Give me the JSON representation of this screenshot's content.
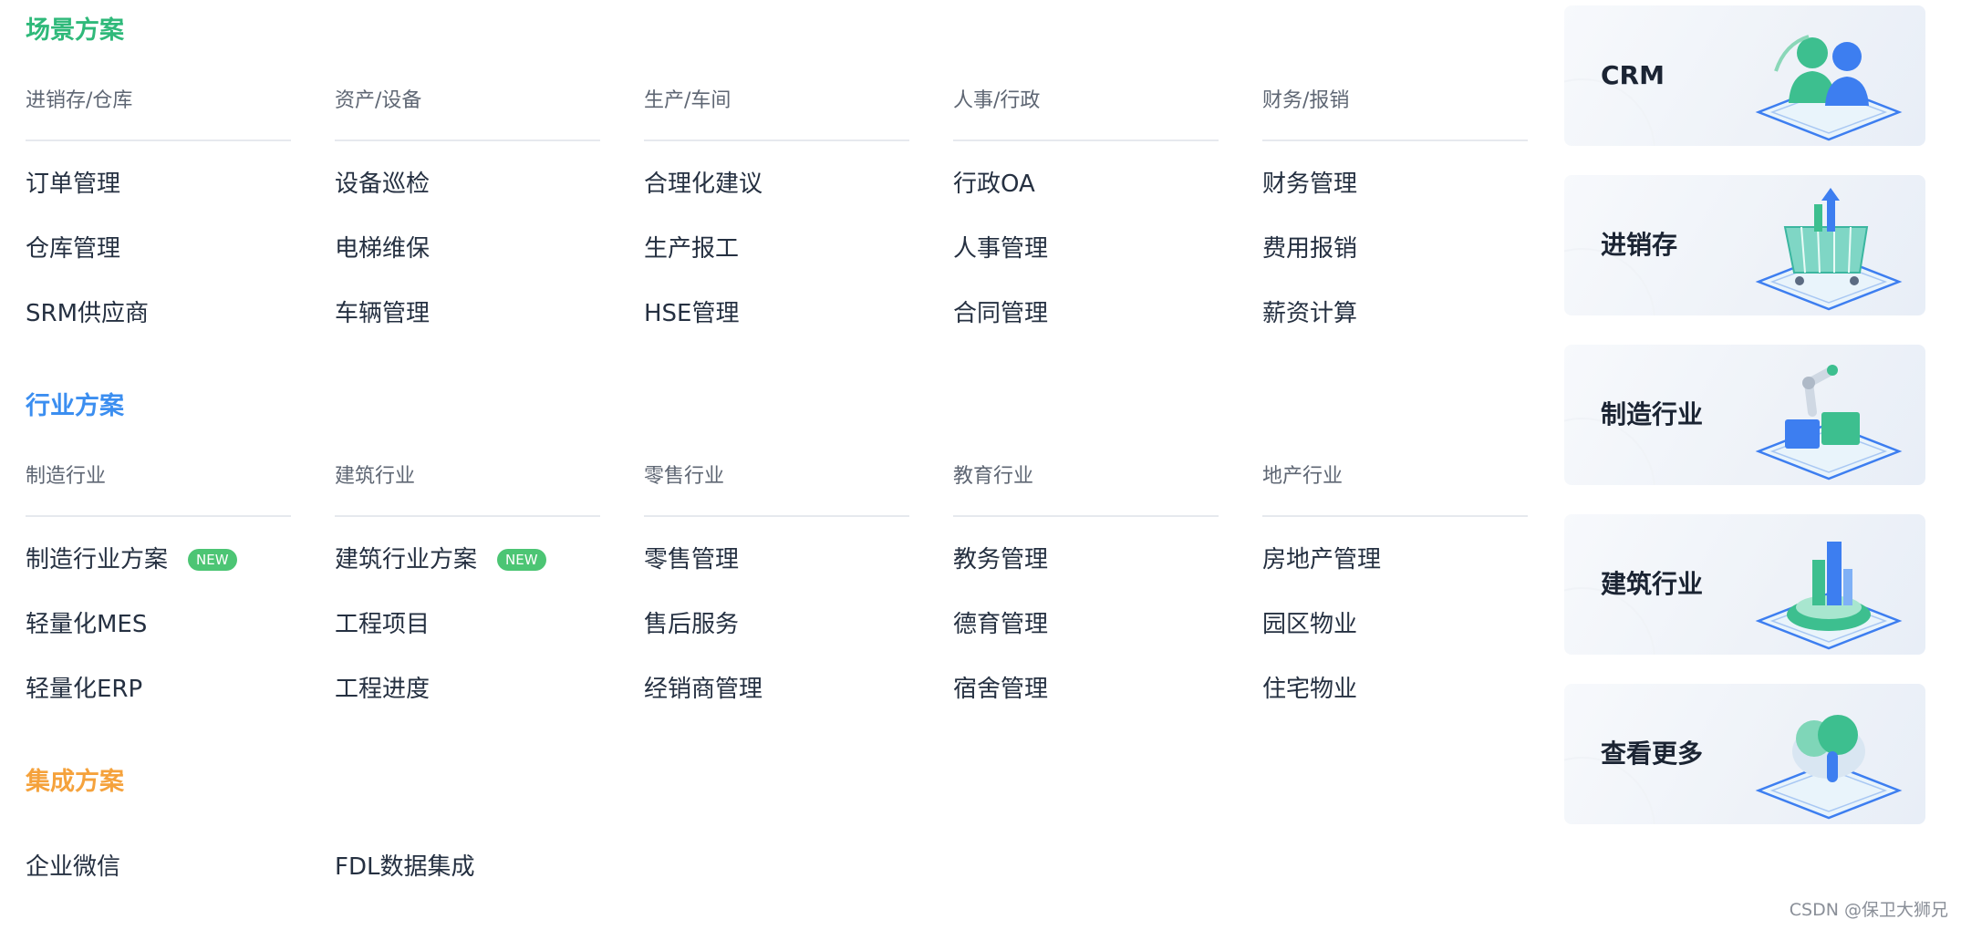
{
  "sections": {
    "scene": {
      "title": "场景方案",
      "color": "#2fb97a",
      "columns": [
        {
          "head": "进销存/仓库",
          "items": [
            "订单管理",
            "仓库管理",
            "SRM供应商"
          ]
        },
        {
          "head": "资产/设备",
          "items": [
            "设备巡检",
            "电梯维保",
            "车辆管理"
          ]
        },
        {
          "head": "生产/车间",
          "items": [
            "合理化建议",
            "生产报工",
            "HSE管理"
          ]
        },
        {
          "head": "人事/行政",
          "items": [
            "行政OA",
            "人事管理",
            "合同管理"
          ]
        },
        {
          "head": "财务/报销",
          "items": [
            "财务管理",
            "费用报销",
            "薪资计算"
          ]
        }
      ]
    },
    "industry": {
      "title": "行业方案",
      "color": "#3b8ef0",
      "columns": [
        {
          "head": "制造行业",
          "items": [
            "制造行业方案",
            "轻量化MES",
            "轻量化ERP"
          ]
        },
        {
          "head": "建筑行业",
          "items": [
            "建筑行业方案",
            "工程项目",
            "工程进度"
          ]
        },
        {
          "head": "零售行业",
          "items": [
            "零售管理",
            "售后服务",
            "经销商管理"
          ]
        },
        {
          "head": "教育行业",
          "items": [
            "教务管理",
            "德育管理",
            "宿舍管理"
          ]
        },
        {
          "head": "地产行业",
          "items": [
            "房地产管理",
            "园区物业",
            "住宅物业"
          ]
        }
      ],
      "badge": "NEW"
    },
    "integration": {
      "title": "集成方案",
      "color": "#f5a23c",
      "items": [
        "企业微信",
        "FDL数据集成"
      ]
    }
  },
  "cards": [
    {
      "label": "CRM",
      "icon": "people-icon"
    },
    {
      "label": "进销存",
      "icon": "cart-icon"
    },
    {
      "label": "制造行业",
      "icon": "robot-arm-icon"
    },
    {
      "label": "建筑行业",
      "icon": "buildings-icon"
    },
    {
      "label": "查看更多",
      "icon": "cloud-icon"
    }
  ],
  "watermark": "CSDN @保卫大狮兄"
}
